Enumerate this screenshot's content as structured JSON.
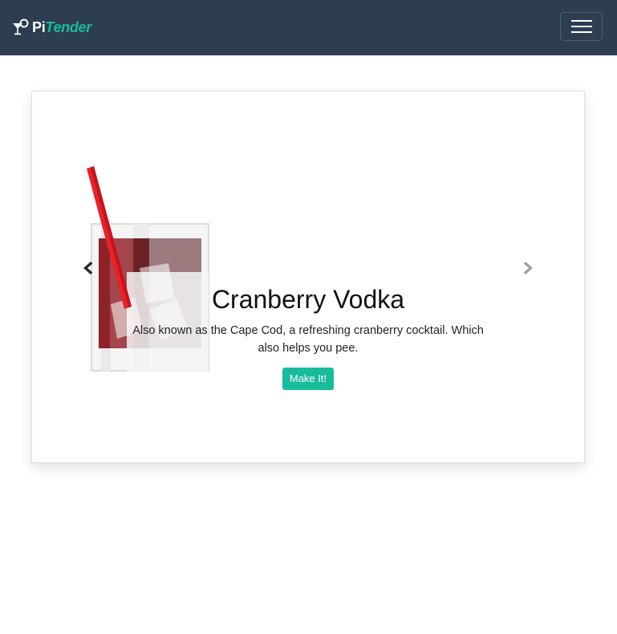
{
  "navbar": {
    "brand_prefix": "Pi",
    "brand_suffix": "Tender",
    "brand_icon": "cocktail-glass-icon",
    "toggler_icon": "hamburger-menu-icon",
    "background": "#2c3e50",
    "accent": "#18bc9c"
  },
  "carousel": {
    "slide": {
      "title": "Cranberry Vodka",
      "description": "Also known as the Cape Cod, a refreshing cranberry cocktail. Which also helps you pee.",
      "button_label": "Make It!",
      "image": "cranberry-vodka-glass-image"
    },
    "prev_icon": "chevron-left-icon",
    "next_icon": "chevron-right-icon"
  }
}
